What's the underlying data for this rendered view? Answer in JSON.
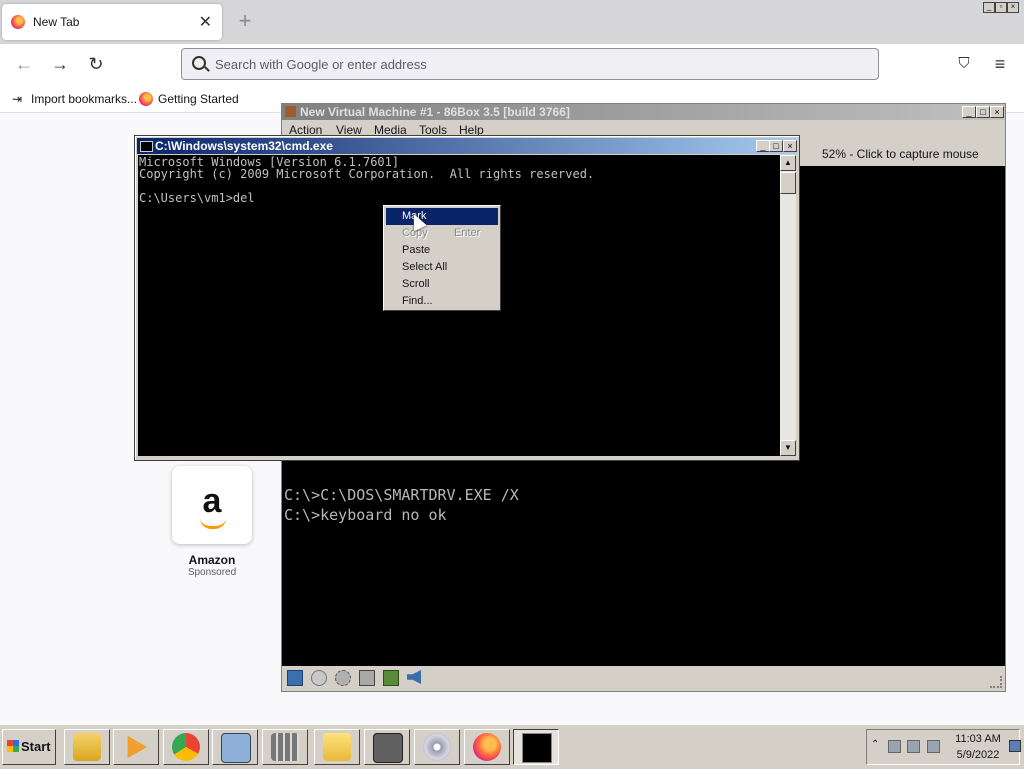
{
  "browser": {
    "tab_title": "New Tab",
    "tab_close": "✕",
    "new_tab": "+",
    "url_placeholder": "Search with Google or enter address",
    "bookmarks": [
      "Import bookmarks...",
      "Getting Started"
    ],
    "sponsored_tile": {
      "letter": "a",
      "name": "Amazon",
      "label": "Sponsored"
    }
  },
  "vm_window": {
    "title": "New Virtual Machine #1 - 86Box 3.5 [build 3766]",
    "menu": [
      "Action",
      "View",
      "Media",
      "Tools",
      "Help"
    ],
    "status": "52% - Click to capture mouse",
    "screen_lines": [
      "C:\\>C:\\DOS\\SMARTDRV.EXE /X",
      "C:\\>keyboard no ok"
    ],
    "toolbar_icons": [
      "floppy-icon",
      "cdrom-icon",
      "network-icon",
      "hdd-icon",
      "settings-icon",
      "sound-icon"
    ]
  },
  "cmd_window": {
    "title": "C:\\Windows\\system32\\cmd.exe",
    "lines": [
      "Microsoft Windows [Version 6.1.7601]",
      "Copyright (c) 2009 Microsoft Corporation.  All rights reserved.",
      "",
      "C:\\Users\\vm1>del"
    ]
  },
  "context_menu": {
    "items": [
      {
        "label": "Mark",
        "shortcut": "",
        "state": "selected"
      },
      {
        "label": "Copy",
        "shortcut": "Enter",
        "state": "disabled"
      },
      {
        "label": "Paste",
        "shortcut": "",
        "state": "normal"
      },
      {
        "label": "Select All",
        "shortcut": "",
        "state": "normal"
      },
      {
        "label": "Scroll",
        "shortcut": "",
        "state": "normal"
      },
      {
        "label": "Find...",
        "shortcut": "",
        "state": "normal"
      }
    ]
  },
  "taskbar": {
    "start_label": "Start",
    "apps": [
      "explorer-icon",
      "media-player-icon",
      "chrome-icon",
      "computer-icon",
      "calculator-icon",
      "folder-icon",
      "tools-icon",
      "cd-icon",
      "firefox-icon",
      "cmd-icon"
    ],
    "active_app": "cmd-icon",
    "time": "11:03 AM",
    "date": "5/9/2022"
  },
  "colors": {
    "title_active": "#0a246a",
    "title_inactive": "#808080",
    "selection": "#0a246a"
  }
}
